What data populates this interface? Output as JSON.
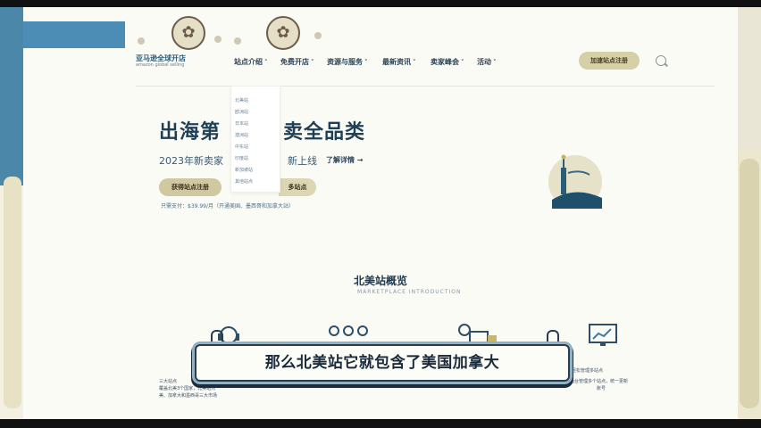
{
  "site": {
    "logo_main": "亚马逊全球开店",
    "logo_sub": "amazon global selling"
  },
  "nav": {
    "items": [
      {
        "label": "站点介绍",
        "has_chevron": true,
        "expanded": true
      },
      {
        "label": "免费开店",
        "has_chevron": true
      },
      {
        "label": "资源与服务",
        "has_chevron": true
      },
      {
        "label": "最新资讯",
        "has_chevron": true
      },
      {
        "label": "卖家峰会",
        "has_chevron": true
      },
      {
        "label": "活动",
        "has_chevron": true
      }
    ],
    "cta_label": "加速站点注册",
    "search_icon": "search-icon"
  },
  "dropdown": {
    "items": [
      "北美站",
      "欧洲站",
      "日本站",
      "澳洲站",
      "中东站",
      "印度站",
      "新加坡站",
      "其他站点"
    ]
  },
  "hero": {
    "title_left": "出海第",
    "title_right": "卖全品类",
    "subtitle_left": "2023年新卖家",
    "subtitle_right": "新上线",
    "link": "了解详情 →",
    "primary_button": "获得站点注册",
    "secondary_button": "多站点",
    "note": "只需支付：$39.99/月（开通美国、墨西哥和加拿大站）"
  },
  "section": {
    "title": "北美站概览",
    "subtitle": "MARKETPLACE INTRODUCTION"
  },
  "features": [
    {
      "icon": "headset-icon",
      "text_lines": [
        "三大站点",
        "覆盖北美3个国家，北美站点",
        "美、加拿大和墨西哥三大市场"
      ]
    },
    {
      "icon": "people-icon",
      "text_lines": [
        ""
      ]
    },
    {
      "icon": "delivery-truck-icon",
      "text_lines": [
        ""
      ]
    },
    {
      "icon": "monitor-chart-icon",
      "text_lines": [
        "轻松管理多站点",
        "统一后台管理多个站点，统一更新",
        "账号"
      ]
    }
  ],
  "caption": {
    "text": "那么北美站它就包含了美国加拿大"
  },
  "colors": {
    "brand_blue": "#4b8db4",
    "heading": "#1f3f55",
    "cta_bg": "#d6d0a8",
    "caption_border": "#2b3b4e"
  }
}
